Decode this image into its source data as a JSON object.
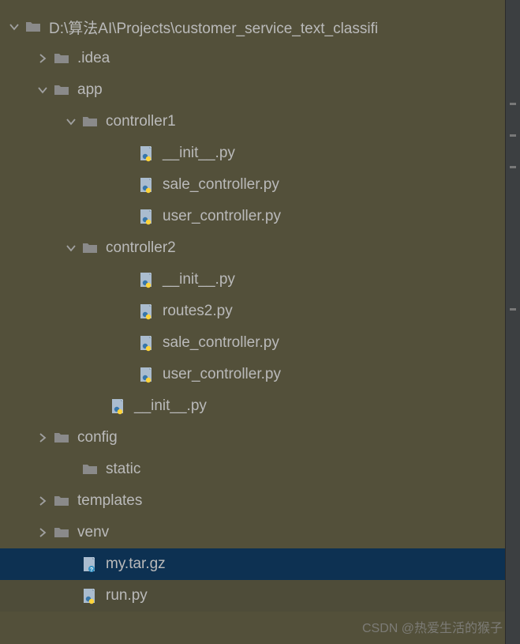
{
  "tree": {
    "root": {
      "label": "D:\\算法AI\\Projects\\customer_service_text_classifi",
      "expanded": true,
      "type": "folder"
    },
    "items": [
      {
        "indent": 1,
        "chevron": "right",
        "type": "folder",
        "label": ".idea"
      },
      {
        "indent": 1,
        "chevron": "down",
        "type": "folder",
        "label": "app"
      },
      {
        "indent": 2,
        "chevron": "down",
        "type": "folder",
        "label": "controller1"
      },
      {
        "indent": 4,
        "chevron": "none",
        "type": "python",
        "label": "__init__.py"
      },
      {
        "indent": 4,
        "chevron": "none",
        "type": "python",
        "label": "sale_controller.py"
      },
      {
        "indent": 4,
        "chevron": "none",
        "type": "python",
        "label": "user_controller.py"
      },
      {
        "indent": 2,
        "chevron": "down",
        "type": "folder",
        "label": "controller2"
      },
      {
        "indent": 4,
        "chevron": "none",
        "type": "python",
        "label": "__init__.py"
      },
      {
        "indent": 4,
        "chevron": "none",
        "type": "python",
        "label": "routes2.py"
      },
      {
        "indent": 4,
        "chevron": "none",
        "type": "python",
        "label": "sale_controller.py"
      },
      {
        "indent": 4,
        "chevron": "none",
        "type": "python",
        "label": "user_controller.py"
      },
      {
        "indent": 3,
        "chevron": "none",
        "type": "python",
        "label": "__init__.py"
      },
      {
        "indent": 1,
        "chevron": "right",
        "type": "folder",
        "label": "config"
      },
      {
        "indent": 2,
        "chevron": "none",
        "type": "folder",
        "label": "static"
      },
      {
        "indent": 1,
        "chevron": "right",
        "type": "folder",
        "label": "templates"
      },
      {
        "indent": 1,
        "chevron": "right",
        "type": "folder",
        "label": "venv"
      },
      {
        "indent": 2,
        "chevron": "none",
        "type": "archive",
        "label": "my.tar.gz",
        "selected": true
      },
      {
        "indent": 2,
        "chevron": "none",
        "type": "python",
        "label": "run.py",
        "dim": true
      }
    ]
  },
  "watermark": "CSDN @热爱生活的猴子"
}
